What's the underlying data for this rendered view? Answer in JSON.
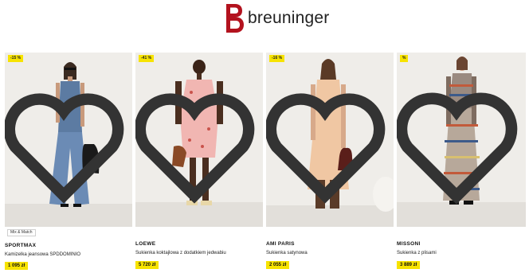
{
  "header": {
    "logo_text": "breuninger",
    "brand_color": "#b3121e"
  },
  "products": [
    {
      "discount": "-15 %",
      "tag": "Mix & Match",
      "brand": "SPORTMAX",
      "name": "Kamizelka jeansowa SPDDOMINIO",
      "price": "1 095 zł"
    },
    {
      "discount": "-41 %",
      "brand": "LOEWE",
      "name": "Sukienka koktajlowa z dodatkiem jedwabiu",
      "price": "5 720 zł"
    },
    {
      "discount": "-16 %",
      "brand": "AMI PARIS",
      "name": "Sukienka satynowa",
      "price": "2 055 zł"
    },
    {
      "discount": "%",
      "brand": "MISSONI",
      "name": "Sukienka z plisami",
      "price": "3 889 zł"
    }
  ],
  "icons": {
    "wishlist": "heart-outline-icon"
  },
  "colors": {
    "price_highlight": "#f7e300",
    "photo_background": "#efede9"
  }
}
